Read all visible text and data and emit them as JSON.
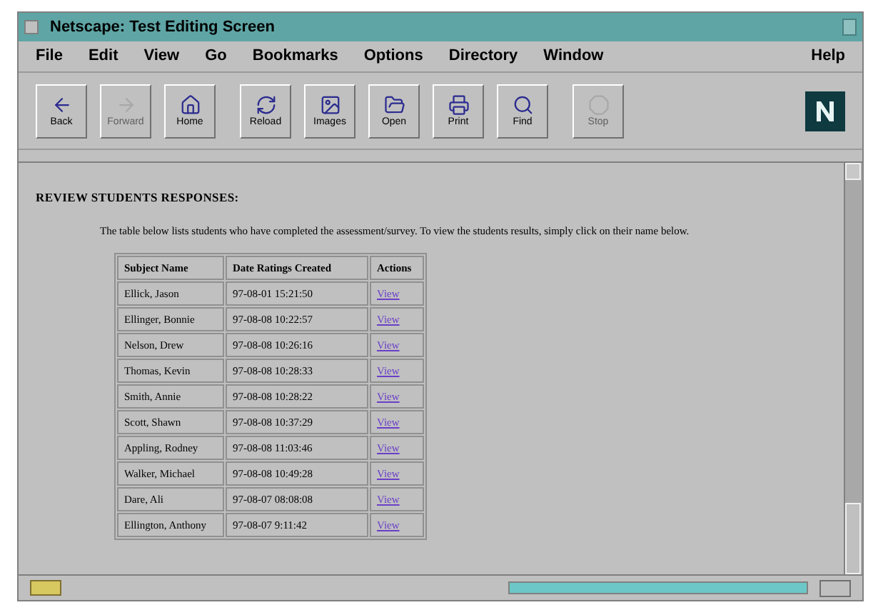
{
  "window": {
    "title": "Netscape: Test Editing Screen"
  },
  "menu": [
    "File",
    "Edit",
    "View",
    "Go",
    "Bookmarks",
    "Options",
    "Directory",
    "Window"
  ],
  "help_menu": "Help",
  "toolbar": [
    {
      "label": "Back",
      "kind": "back",
      "disabled": false
    },
    {
      "label": "Forward",
      "kind": "forward",
      "disabled": true
    },
    {
      "label": "Home",
      "kind": "home",
      "disabled": false
    },
    {
      "label": "Reload",
      "kind": "reload",
      "disabled": false
    },
    {
      "label": "Images",
      "kind": "images",
      "disabled": false
    },
    {
      "label": "Open",
      "kind": "open",
      "disabled": false
    },
    {
      "label": "Print",
      "kind": "print",
      "disabled": false
    },
    {
      "label": "Find",
      "kind": "find",
      "disabled": false
    },
    {
      "label": "Stop",
      "kind": "stop",
      "disabled": true
    }
  ],
  "page": {
    "heading": "REVIEW STUDENTS RESPONSES:",
    "intro": "The table below lists students who have completed the assessment/survey. To view the students results, simply click on their name below.",
    "table": {
      "columns": [
        "Subject Name",
        "Date Ratings Created",
        "Actions"
      ],
      "rows": [
        {
          "name": "Ellick, Jason",
          "date": "97-08-01 15:21:50",
          "action": "View"
        },
        {
          "name": "Ellinger, Bonnie",
          "date": "97-08-08 10:22:57",
          "action": "View"
        },
        {
          "name": "Nelson, Drew",
          "date": "97-08-08 10:26:16",
          "action": "View"
        },
        {
          "name": "Thomas, Kevin",
          "date": "97-08-08 10:28:33",
          "action": "View"
        },
        {
          "name": "Smith, Annie",
          "date": "97-08-08 10:28:22",
          "action": "View"
        },
        {
          "name": "Scott, Shawn",
          "date": "97-08-08 10:37:29",
          "action": "View"
        },
        {
          "name": "Appling, Rodney",
          "date": "97-08-08 11:03:46",
          "action": "View"
        },
        {
          "name": "Walker, Michael",
          "date": "97-08-08 10:49:28",
          "action": "View"
        },
        {
          "name": "Dare, Ali",
          "date": "97-08-07 08:08:08",
          "action": "View"
        },
        {
          "name": "Ellington, Anthony",
          "date": "97-08-07 9:11:42",
          "action": "View"
        }
      ]
    }
  },
  "status_bar": {
    "progress": {
      "level": 1
    }
  }
}
